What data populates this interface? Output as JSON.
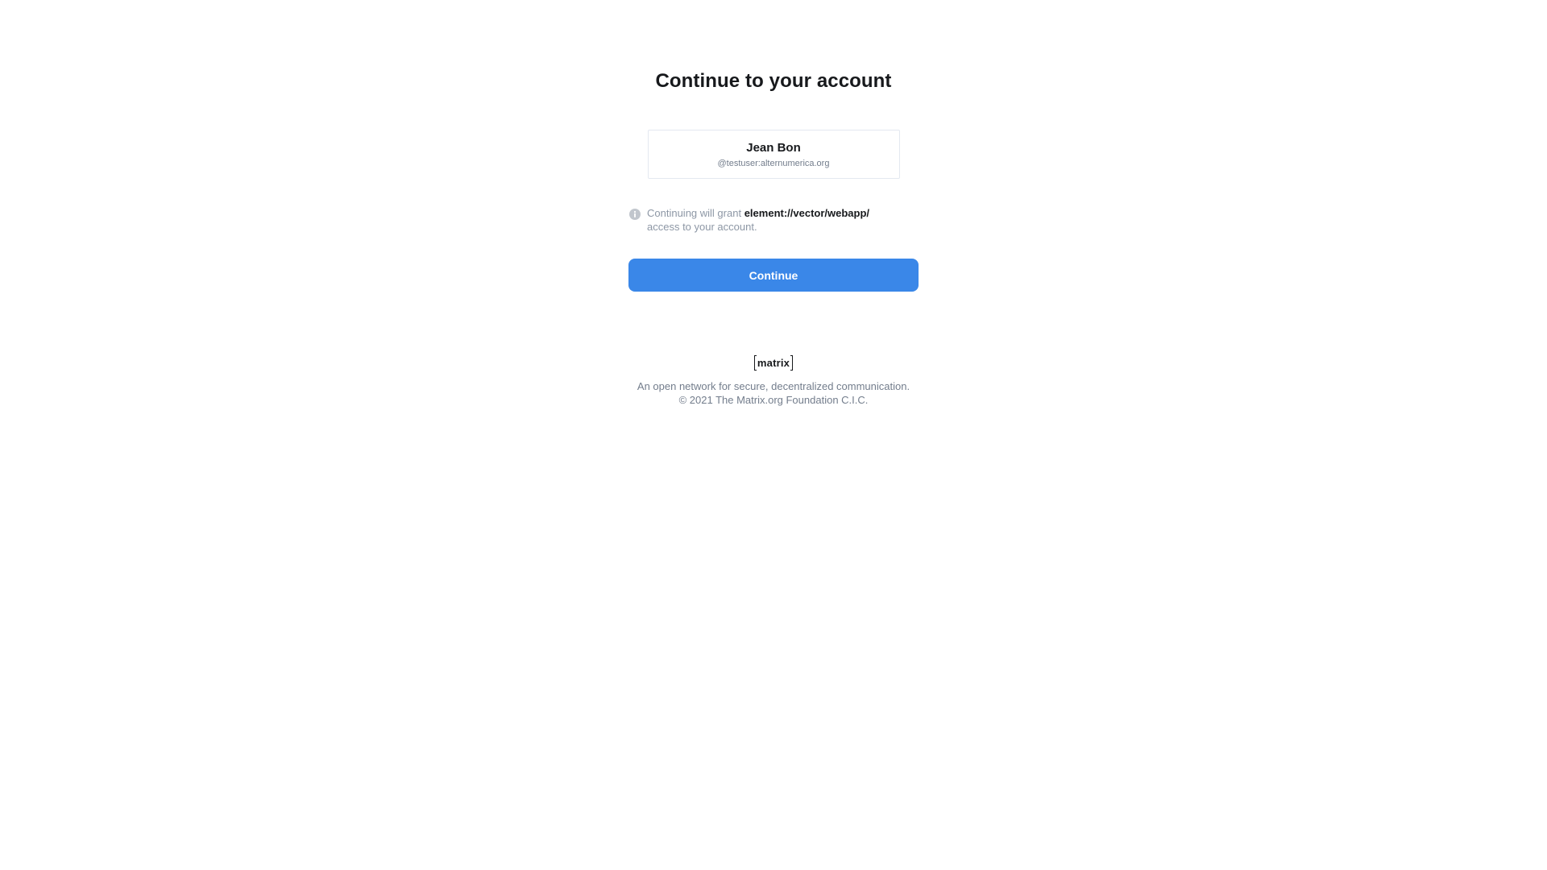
{
  "page": {
    "title": "Continue to your account"
  },
  "account": {
    "display_name": "Jean Bon",
    "mxid": "@testuser:alternumerica.org"
  },
  "grant": {
    "prefix": "Continuing will grant",
    "client": "element://vector/webapp/",
    "suffix": "access to your account.",
    "icon": "info-icon"
  },
  "actions": {
    "continue_label": "Continue"
  },
  "footer": {
    "logo_text": "matrix",
    "tagline": "An open network for secure, decentralized communication.",
    "copyright": "© 2021 The Matrix.org Foundation C.I.C."
  },
  "colors": {
    "primary": "#3a87e8",
    "text": "#17191c",
    "muted": "#737d8c",
    "border": "#e3e8f0"
  }
}
